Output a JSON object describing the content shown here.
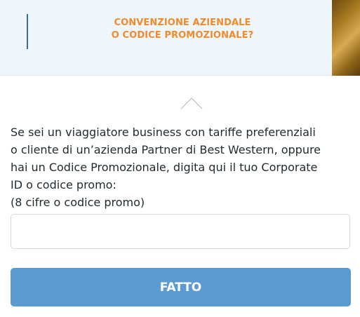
{
  "header": {
    "title_line1": "CONVENZIONE AZIENDALE",
    "title_line2": "O CODICE PROMOZIONALE?"
  },
  "description": {
    "lines": [
      "Se sei un viaggiatore business con tariffe preferenziali",
      "o cliente di un’azienda Partner di Best Western, oppure",
      "hai un Codice Promozionale, digita qui il tuo Corporate",
      "ID o codice promo:",
      "(8 cifre o codice promo)"
    ]
  },
  "promo_input": {
    "value": "",
    "placeholder": ""
  },
  "done_button": {
    "label": "FATTO"
  },
  "colors": {
    "accent_orange": "#f08a2a",
    "button_blue": "#5b9bd1",
    "header_bg": "#eef6fb",
    "divider_blue": "#3a6f94"
  },
  "icons": {
    "collapse": "chevron-up-icon"
  }
}
